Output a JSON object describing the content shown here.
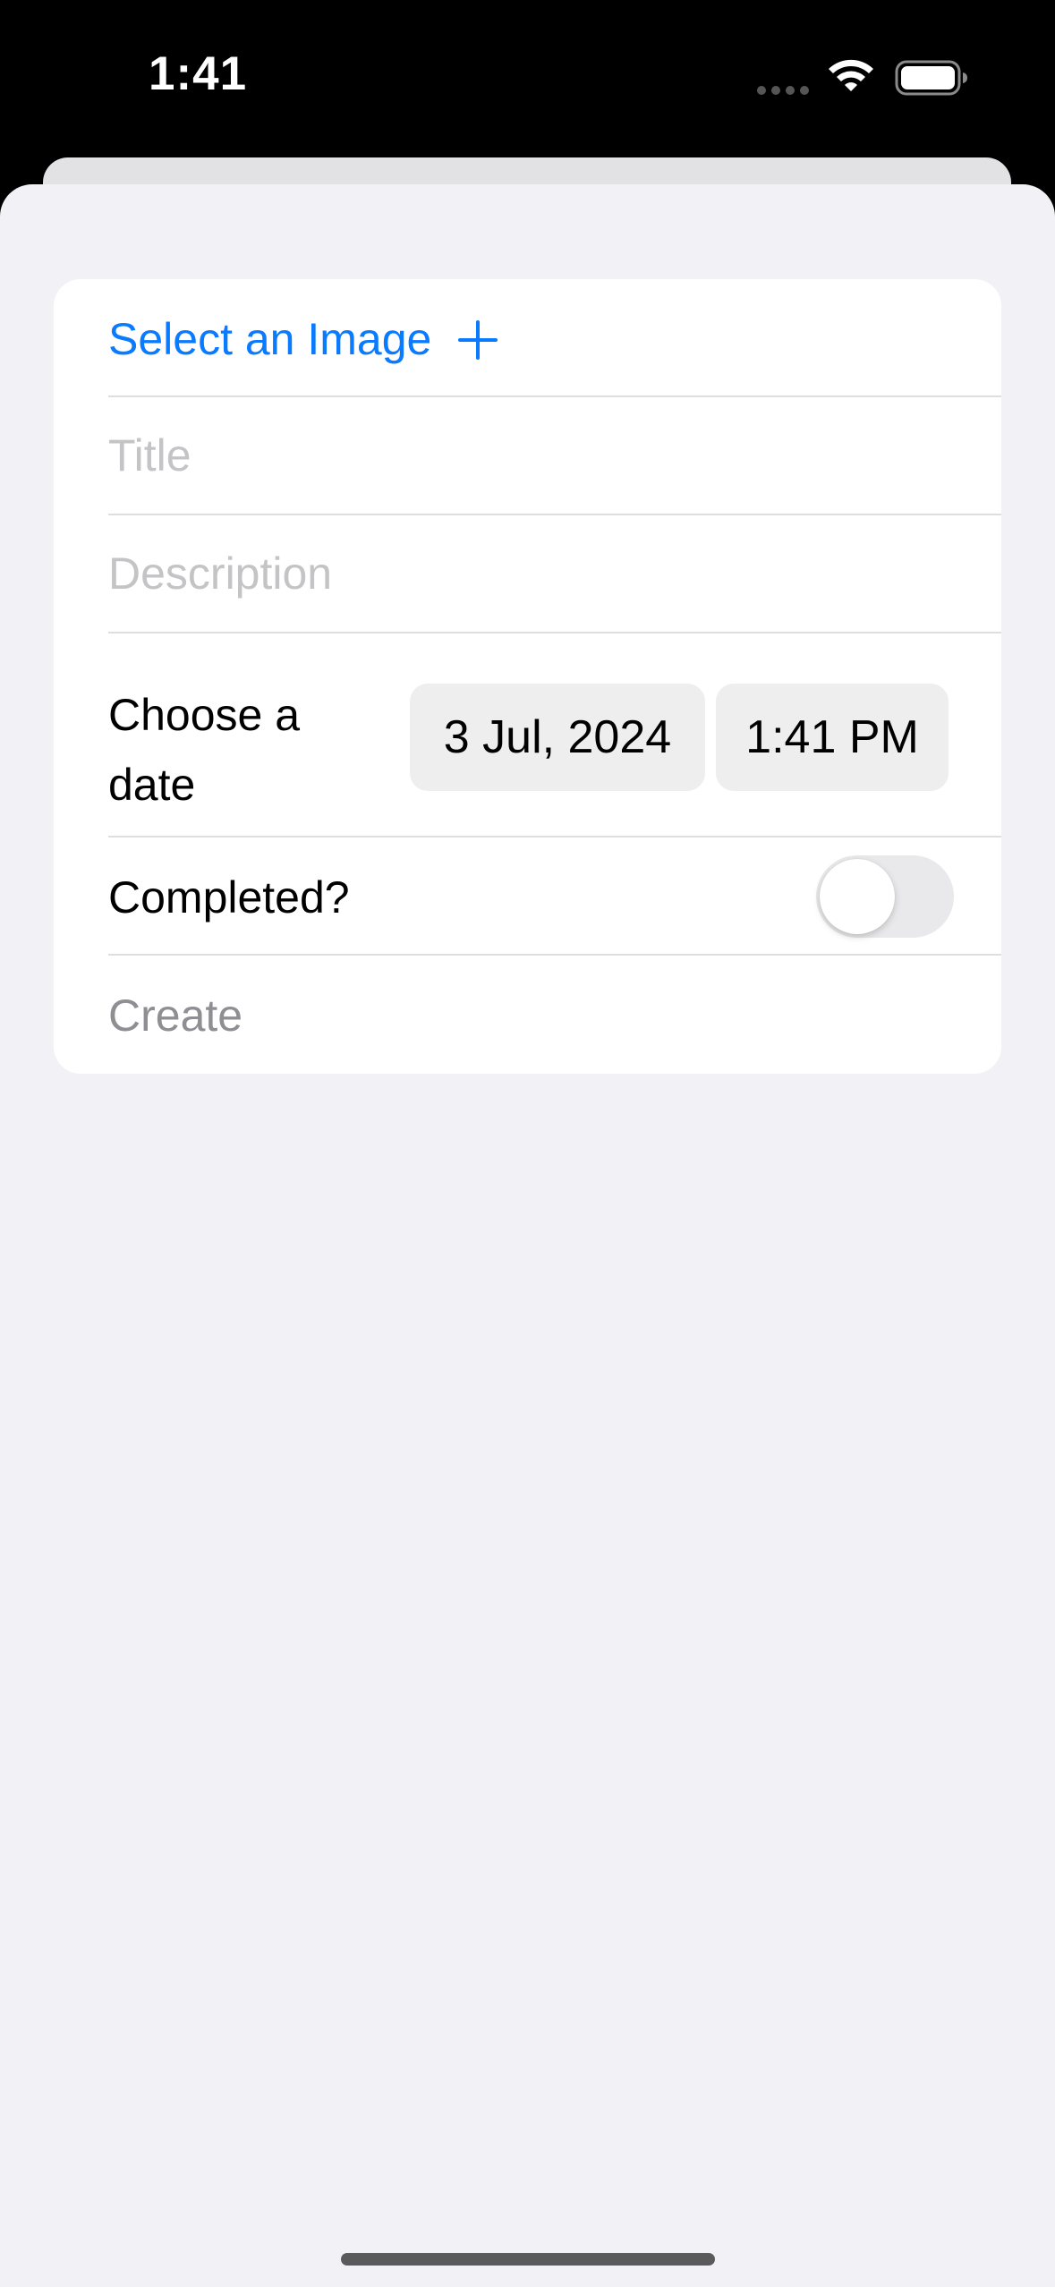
{
  "status_bar": {
    "time": "1:41"
  },
  "form": {
    "select_image_label": "Select an Image",
    "title_placeholder": "Title",
    "description_placeholder": "Description",
    "date_label": "Choose a date",
    "date_value": "3 Jul, 2024",
    "time_value": "1:41 PM",
    "completed_label": "Completed?",
    "completed_on": false,
    "create_label": "Create"
  },
  "colors": {
    "accent": "#0A7AFF",
    "disabled_text": "#8E8E93",
    "placeholder": "#C4C4C6",
    "background": "#F1F1F6"
  },
  "icons": {
    "add": "plus-icon",
    "wifi": "wifi-icon",
    "battery": "battery-icon",
    "cellular": "cellular-dots-icon"
  }
}
